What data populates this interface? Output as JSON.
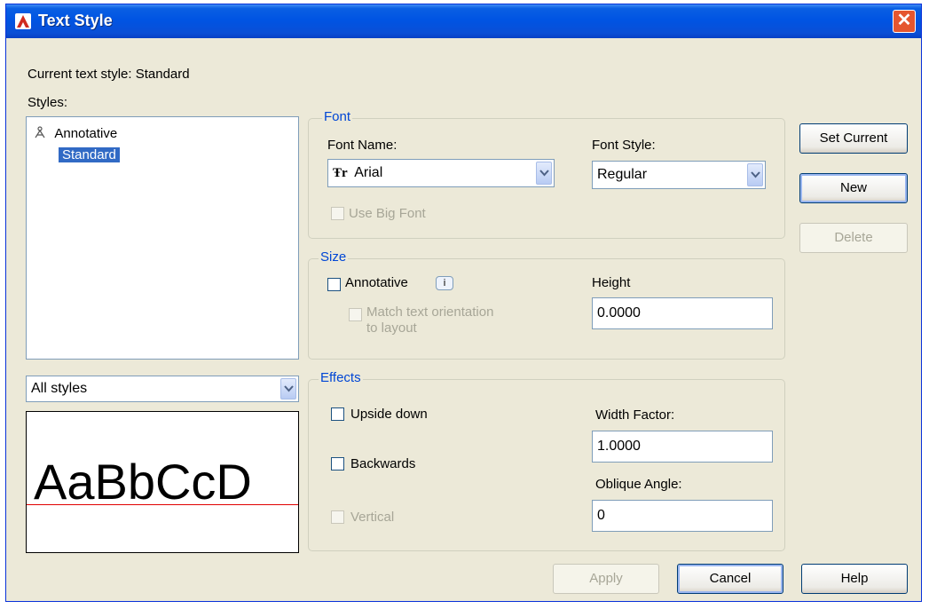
{
  "window": {
    "title": "Text Style",
    "close_symbol": "✕"
  },
  "current_style": {
    "label": "Current text style:",
    "value": "Standard"
  },
  "styles": {
    "label": "Styles:",
    "items": [
      {
        "label": "Annotative",
        "icon": "annotative-icon"
      },
      {
        "label": "Standard",
        "selected": true
      }
    ]
  },
  "filter": {
    "value": "All styles"
  },
  "preview": {
    "text": "AaBbCcD"
  },
  "font": {
    "group_label": "Font",
    "font_name_label": "Font Name:",
    "font_name_value": "Arial",
    "font_style_label": "Font Style:",
    "font_style_value": "Regular",
    "big_font_label": "Use Big Font"
  },
  "size": {
    "group_label": "Size",
    "annotative_label": "Annotative",
    "info_badge": "i",
    "match_orientation_line1": "Match text orientation",
    "match_orientation_line2": "to layout",
    "height_label": "Height",
    "height_value": "0.0000"
  },
  "effects": {
    "group_label": "Effects",
    "upside_down_label": "Upside down",
    "backwards_label": "Backwards",
    "vertical_label": "Vertical",
    "width_factor_label": "Width Factor:",
    "width_factor_value": "1.0000",
    "oblique_label": "Oblique Angle:",
    "oblique_value": "0"
  },
  "buttons": {
    "set_current": "Set Current",
    "new": "New",
    "delete": "Delete",
    "apply": "Apply",
    "cancel": "Cancel",
    "help": "Help"
  },
  "colors": {
    "title_bar": "#0054e3",
    "group_label": "#0046d5",
    "selection": "#316ac5",
    "baseline": "#e00000"
  }
}
